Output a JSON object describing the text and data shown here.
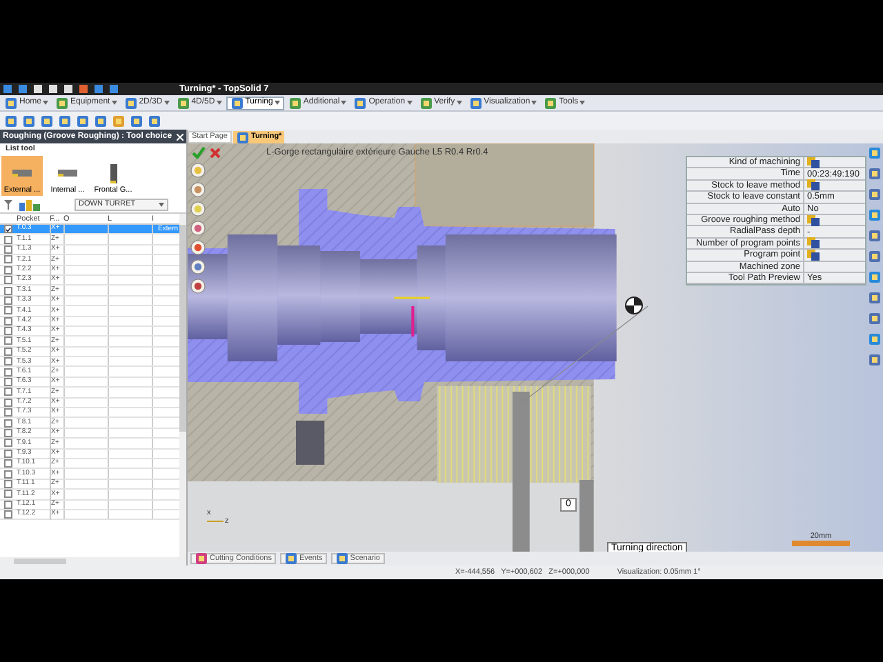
{
  "window": {
    "title": "Turning* - TopSolid 7"
  },
  "menu": [
    {
      "label": "Home",
      "selected": false
    },
    {
      "label": "Equipment",
      "selected": false
    },
    {
      "label": "2D/3D",
      "selected": false
    },
    {
      "label": "4D/5D",
      "selected": false
    },
    {
      "label": "Turning",
      "selected": true
    },
    {
      "label": "Additional",
      "selected": false
    },
    {
      "label": "Operation",
      "selected": false
    },
    {
      "label": "Verify",
      "selected": false
    },
    {
      "label": "Visualization",
      "selected": false
    },
    {
      "label": "Tools",
      "selected": false
    }
  ],
  "panel": {
    "title": "Roughing (Groove Roughing) : Tool choice",
    "section": "List tool",
    "tool_types": [
      {
        "label": "External ...",
        "selected": true
      },
      {
        "label": "Internal ...",
        "selected": false
      },
      {
        "label": "Frontal G...",
        "selected": false
      }
    ],
    "turret": "DOWN TURRET",
    "columns": [
      "Pocket",
      "F...",
      "O",
      "L",
      "I"
    ],
    "rows": [
      {
        "pocket": "T.0.3",
        "f": "X+",
        "i": "Extern",
        "checked": true,
        "selected": true
      },
      {
        "pocket": "T.1.1",
        "f": "Z+",
        "checked": false,
        "selected": false
      },
      {
        "pocket": "T.1.3",
        "f": "X+",
        "checked": false,
        "selected": false
      },
      {
        "pocket": "T.2.1",
        "f": "Z+",
        "checked": false,
        "selected": false
      },
      {
        "pocket": "T.2.2",
        "f": "X+",
        "checked": false,
        "selected": false
      },
      {
        "pocket": "T.2.3",
        "f": "X+",
        "checked": false,
        "selected": false
      },
      {
        "pocket": "T.3.1",
        "f": "Z+",
        "checked": false,
        "selected": false
      },
      {
        "pocket": "T.3.3",
        "f": "X+",
        "checked": false,
        "selected": false
      },
      {
        "pocket": "T.4.1",
        "f": "X+",
        "checked": false,
        "selected": false
      },
      {
        "pocket": "T.4.2",
        "f": "X+",
        "checked": false,
        "selected": false
      },
      {
        "pocket": "T.4.3",
        "f": "X+",
        "checked": false,
        "selected": false
      },
      {
        "pocket": "T.5.1",
        "f": "Z+",
        "checked": false,
        "selected": false
      },
      {
        "pocket": "T.5.2",
        "f": "X+",
        "checked": false,
        "selected": false
      },
      {
        "pocket": "T.5.3",
        "f": "X+",
        "checked": false,
        "selected": false
      },
      {
        "pocket": "T.6.1",
        "f": "Z+",
        "checked": false,
        "selected": false
      },
      {
        "pocket": "T.6.3",
        "f": "X+",
        "checked": false,
        "selected": false
      },
      {
        "pocket": "T.7.1",
        "f": "Z+",
        "checked": false,
        "selected": false
      },
      {
        "pocket": "T.7.2",
        "f": "X+",
        "checked": false,
        "selected": false
      },
      {
        "pocket": "T.7.3",
        "f": "X+",
        "checked": false,
        "selected": false
      },
      {
        "pocket": "T.8.1",
        "f": "Z+",
        "checked": false,
        "selected": false
      },
      {
        "pocket": "T.8.2",
        "f": "X+",
        "checked": false,
        "selected": false
      },
      {
        "pocket": "T.9.1",
        "f": "Z+",
        "checked": false,
        "selected": false
      },
      {
        "pocket": "T.9.3",
        "f": "X+",
        "checked": false,
        "selected": false
      },
      {
        "pocket": "T.10.1",
        "f": "Z+",
        "checked": false,
        "selected": false
      },
      {
        "pocket": "T.10.3",
        "f": "X+",
        "checked": false,
        "selected": false
      },
      {
        "pocket": "T.11.1",
        "f": "Z+",
        "checked": false,
        "selected": false
      },
      {
        "pocket": "T.11.2",
        "f": "X+",
        "checked": false,
        "selected": false
      },
      {
        "pocket": "T.12.1",
        "f": "Z+",
        "checked": false,
        "selected": false
      },
      {
        "pocket": "T.12.2",
        "f": "X+",
        "checked": false,
        "selected": false
      }
    ]
  },
  "doc_tabs": [
    {
      "label": "Start Page",
      "selected": false
    },
    {
      "label": "Turning*",
      "selected": true
    }
  ],
  "viewport": {
    "operation": "L-Gorge rectangulaire extérieure Gauche L5 R0.4 Rr0.4",
    "properties": [
      {
        "name": "Kind of machining",
        "kind": "icon"
      },
      {
        "name": "Time",
        "kind": "text",
        "value": "00:23:49:190"
      },
      {
        "name": "Stock to leave method",
        "kind": "icon"
      },
      {
        "name": "Stock to leave constant",
        "kind": "text",
        "value": "0.5mm"
      },
      {
        "name": "Auto",
        "kind": "text",
        "value": "No"
      },
      {
        "name": "Groove roughing method",
        "kind": "icon"
      },
      {
        "name": "RadialPass depth",
        "kind": "text",
        "value": "-"
      },
      {
        "name": "Number of program points",
        "kind": "icon"
      },
      {
        "name": "Program point",
        "kind": "icon"
      },
      {
        "name": "Machined zone",
        "kind": "empty"
      },
      {
        "name": "Tool Path Preview",
        "kind": "text",
        "value": "Yes"
      }
    ],
    "dimension": "0",
    "turning_direction": "Turning direction",
    "scale": "20mm",
    "axis_x": "x",
    "axis_z": "z"
  },
  "bottom_tabs": [
    {
      "label": "Cutting Conditions",
      "selected": false
    },
    {
      "label": "Events",
      "selected": false
    },
    {
      "label": "Scenario",
      "selected": false
    }
  ],
  "status_bar": {
    "coordinates": "X=-444,556   Y=+000,602   Z=+000,000",
    "visualization": "Visualization: 0.05mm 1°"
  }
}
